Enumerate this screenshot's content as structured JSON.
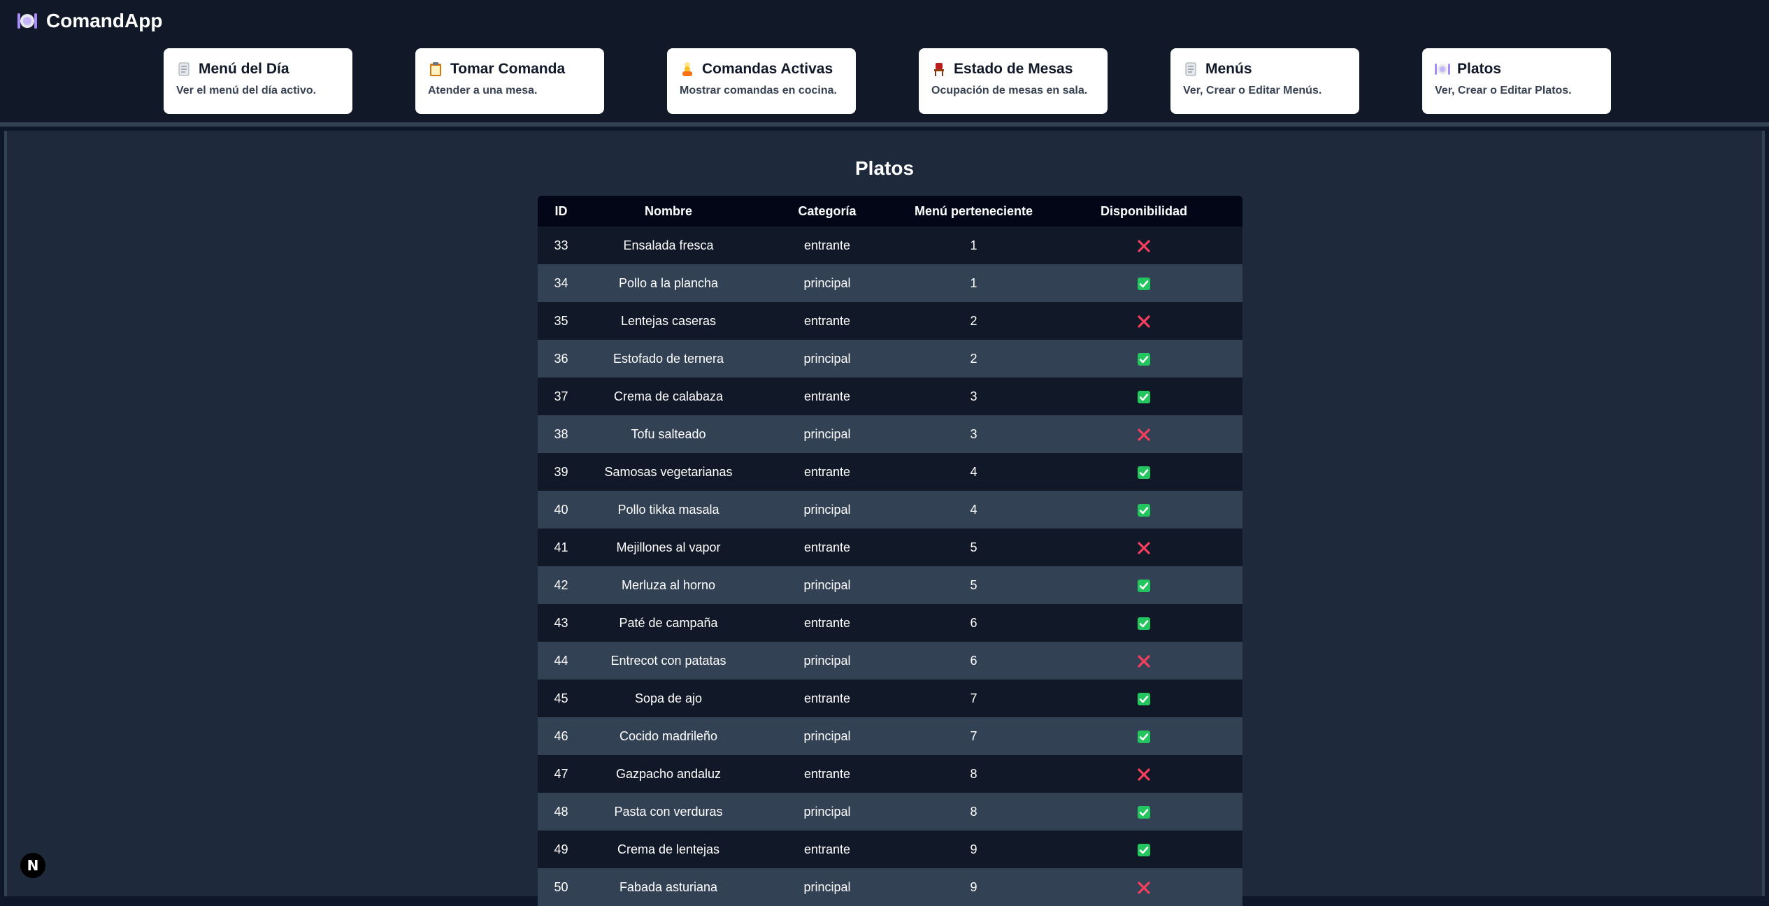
{
  "app": {
    "name": "ComandApp",
    "icon": "plate-icon"
  },
  "nav": [
    {
      "title": "Menú del Día",
      "desc": "Ver el menú del día activo.",
      "icon": "scroll-icon"
    },
    {
      "title": "Tomar Comanda",
      "desc": "Atender a una mesa.",
      "icon": "clipboard-icon"
    },
    {
      "title": "Comandas Activas",
      "desc": "Mostrar comandas en cocina.",
      "icon": "cook-icon"
    },
    {
      "title": "Estado de Mesas",
      "desc": "Ocupación de mesas en sala.",
      "icon": "chair-icon"
    },
    {
      "title": "Menús",
      "desc": "Ver, Crear o Editar Menús.",
      "icon": "scroll-icon"
    },
    {
      "title": "Platos",
      "desc": "Ver, Crear o Editar Platos.",
      "icon": "plate-icon"
    }
  ],
  "page": {
    "title": "Platos"
  },
  "table": {
    "headers": [
      "ID",
      "Nombre",
      "Categoría",
      "Menú perteneciente",
      "Disponibilidad"
    ],
    "rows": [
      {
        "id": "33",
        "nombre": "Ensalada fresca",
        "categoria": "entrante",
        "menu": "1",
        "disponible": false
      },
      {
        "id": "34",
        "nombre": "Pollo a la plancha",
        "categoria": "principal",
        "menu": "1",
        "disponible": true
      },
      {
        "id": "35",
        "nombre": "Lentejas caseras",
        "categoria": "entrante",
        "menu": "2",
        "disponible": false
      },
      {
        "id": "36",
        "nombre": "Estofado de ternera",
        "categoria": "principal",
        "menu": "2",
        "disponible": true
      },
      {
        "id": "37",
        "nombre": "Crema de calabaza",
        "categoria": "entrante",
        "menu": "3",
        "disponible": true
      },
      {
        "id": "38",
        "nombre": "Tofu salteado",
        "categoria": "principal",
        "menu": "3",
        "disponible": false
      },
      {
        "id": "39",
        "nombre": "Samosas vegetarianas",
        "categoria": "entrante",
        "menu": "4",
        "disponible": true
      },
      {
        "id": "40",
        "nombre": "Pollo tikka masala",
        "categoria": "principal",
        "menu": "4",
        "disponible": true
      },
      {
        "id": "41",
        "nombre": "Mejillones al vapor",
        "categoria": "entrante",
        "menu": "5",
        "disponible": false
      },
      {
        "id": "42",
        "nombre": "Merluza al horno",
        "categoria": "principal",
        "menu": "5",
        "disponible": true
      },
      {
        "id": "43",
        "nombre": "Paté de campaña",
        "categoria": "entrante",
        "menu": "6",
        "disponible": true
      },
      {
        "id": "44",
        "nombre": "Entrecot con patatas",
        "categoria": "principal",
        "menu": "6",
        "disponible": false
      },
      {
        "id": "45",
        "nombre": "Sopa de ajo",
        "categoria": "entrante",
        "menu": "7",
        "disponible": true
      },
      {
        "id": "46",
        "nombre": "Cocido madrileño",
        "categoria": "principal",
        "menu": "7",
        "disponible": true
      },
      {
        "id": "47",
        "nombre": "Gazpacho andaluz",
        "categoria": "entrante",
        "menu": "8",
        "disponible": false
      },
      {
        "id": "48",
        "nombre": "Pasta con verduras",
        "categoria": "principal",
        "menu": "8",
        "disponible": true
      },
      {
        "id": "49",
        "nombre": "Crema de lentejas",
        "categoria": "entrante",
        "menu": "9",
        "disponible": true
      },
      {
        "id": "50",
        "nombre": "Fabada asturiana",
        "categoria": "principal",
        "menu": "9",
        "disponible": false
      }
    ]
  },
  "dev_indicator": {
    "label": "N"
  },
  "colors": {
    "available": "#22c55e",
    "unavailable": "#f43f5e",
    "header_bg": "#111827",
    "main_bg": "#1e293b"
  }
}
